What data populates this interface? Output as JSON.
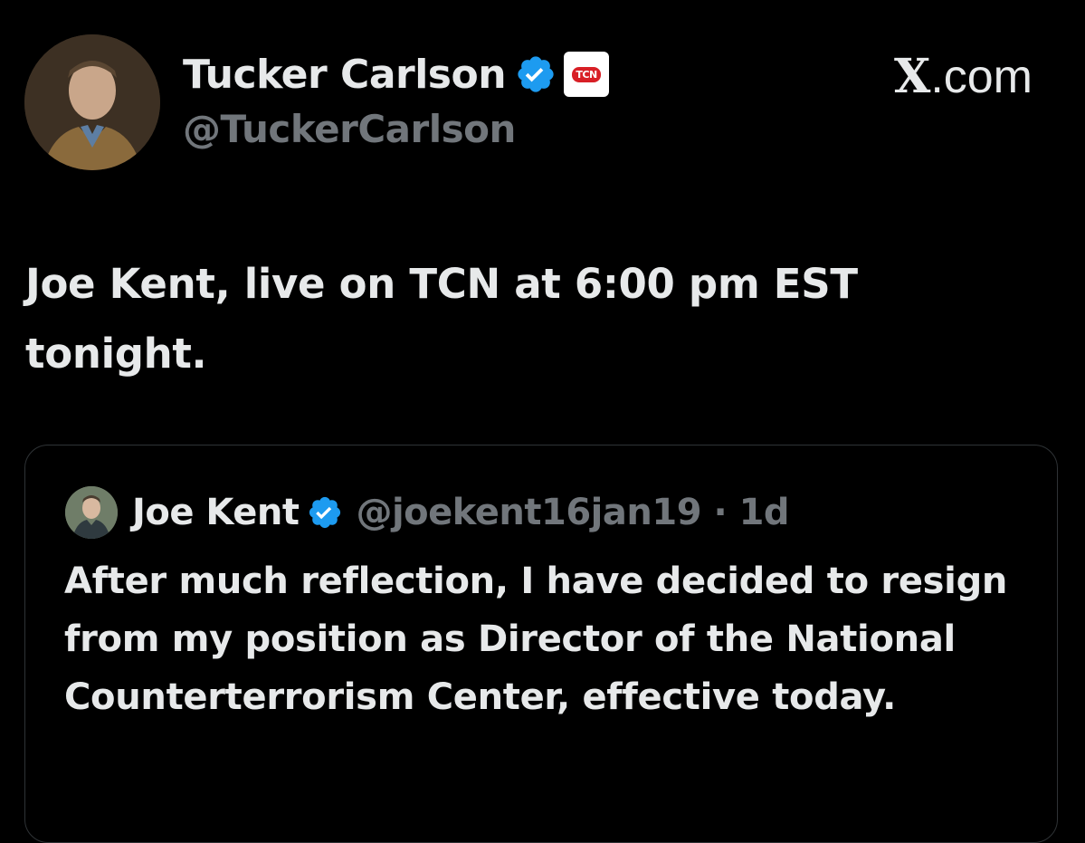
{
  "post": {
    "author": {
      "display_name": "Tucker Carlson",
      "handle": "@TuckerCarlson",
      "verified": true,
      "affiliate_badge": "TCN",
      "avatar_icon": "profile-photo"
    },
    "text": "Joe Kent, live on TCN at 6:00 pm EST tonight."
  },
  "brand": {
    "x_glyph": "X",
    "suffix": ".com"
  },
  "quoted_post": {
    "author": {
      "display_name": "Joe Kent",
      "handle": "@joekent16jan19",
      "verified": true,
      "avatar_icon": "profile-photo"
    },
    "meta": "@joekent16jan19 · 1d",
    "text": "After much reflection, I have decided to resign from my position as Director of the National Counterterrorism Center, effective today."
  },
  "colors": {
    "background": "#000000",
    "primary_text": "#e7e9ea",
    "secondary_text": "#71767b",
    "verified_blue": "#1d9bf0",
    "border": "#2f3336",
    "tcn_red": "#d81f26"
  }
}
